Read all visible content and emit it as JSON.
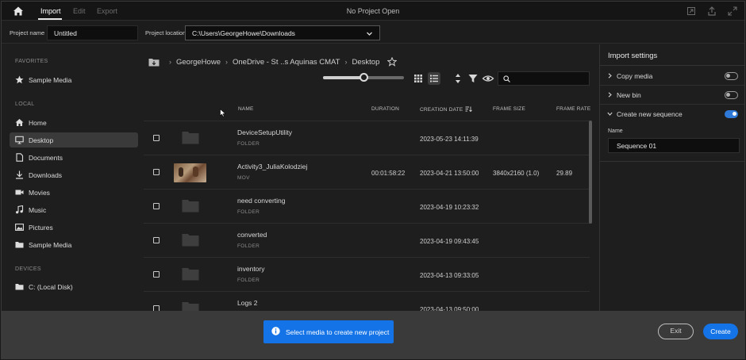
{
  "topbar": {
    "tabs": [
      "Import",
      "Edit",
      "Export"
    ],
    "status": "No Project Open"
  },
  "project": {
    "name_label": "Project name",
    "name_value": "Untitled",
    "location_label": "Project location",
    "location_value": "C:\\Users\\GeorgeHowe\\Downloads"
  },
  "sidebar": {
    "favorites_label": "FAVORITES",
    "favorites": [
      {
        "label": "Sample Media",
        "icon": "star-icon"
      }
    ],
    "local_label": "LOCAL",
    "local": [
      {
        "label": "Home",
        "icon": "home-icon"
      },
      {
        "label": "Desktop",
        "icon": "monitor-icon",
        "selected": true
      },
      {
        "label": "Documents",
        "icon": "document-icon"
      },
      {
        "label": "Downloads",
        "icon": "download-icon"
      },
      {
        "label": "Movies",
        "icon": "video-camera-icon"
      },
      {
        "label": "Music",
        "icon": "music-note-icon"
      },
      {
        "label": "Pictures",
        "icon": "image-icon"
      },
      {
        "label": "Sample Media",
        "icon": "folder-icon"
      }
    ],
    "devices_label": "DEVICES",
    "devices": [
      {
        "label": "C: (Local Disk)",
        "icon": "folder-icon"
      }
    ]
  },
  "breadcrumb": [
    "GeorgeHowe",
    "OneDrive - St ..s Aquinas CMAT",
    "Desktop"
  ],
  "columns": {
    "name": "NAME",
    "duration": "DURATION",
    "creation_date": "CREATION DATE",
    "frame_size": "FRAME SIZE",
    "frame_rate": "FRAME RATE"
  },
  "files": [
    {
      "name": "DeviceSetupUtility",
      "type": "FOLDER",
      "duration": "",
      "date": "2023-05-23 14:11:39",
      "frame_size": "",
      "frame_rate": "",
      "thumb": "folder"
    },
    {
      "name": "Activity3_JuliaKolodziej",
      "type": "MOV",
      "duration": "00:01:58:22",
      "date": "2023-04-21 13:50:00",
      "frame_size": "3840x2160 (1.0)",
      "frame_rate": "29.89",
      "thumb": "video"
    },
    {
      "name": "need converting",
      "type": "FOLDER",
      "duration": "",
      "date": "2023-04-19 10:23:32",
      "frame_size": "",
      "frame_rate": "",
      "thumb": "folder"
    },
    {
      "name": "converted",
      "type": "FOLDER",
      "duration": "",
      "date": "2023-04-19 09:43:45",
      "frame_size": "",
      "frame_rate": "",
      "thumb": "folder"
    },
    {
      "name": "inventory",
      "type": "FOLDER",
      "duration": "",
      "date": "2023-04-13 09:33:05",
      "frame_size": "",
      "frame_rate": "",
      "thumb": "folder"
    },
    {
      "name": "Logs 2",
      "type": "FOLDER",
      "duration": "",
      "date": "2023-04-13 09:50:00",
      "frame_size": "",
      "frame_rate": "",
      "thumb": "folder"
    }
  ],
  "thumbnail_size": 0.5,
  "import_settings": {
    "title": "Import settings",
    "copy_media": {
      "label": "Copy media",
      "enabled": false
    },
    "new_bin": {
      "label": "New bin",
      "enabled": false
    },
    "new_sequence": {
      "label": "Create new sequence",
      "enabled": true
    },
    "sequence_name_label": "Name",
    "sequence_name_value": "Sequence 01"
  },
  "footer": {
    "message": "Select media to create new project",
    "exit_label": "Exit",
    "create_label": "Create"
  },
  "colors": {
    "accent": "#1473e6",
    "toggle_on": "#2f79d8"
  }
}
